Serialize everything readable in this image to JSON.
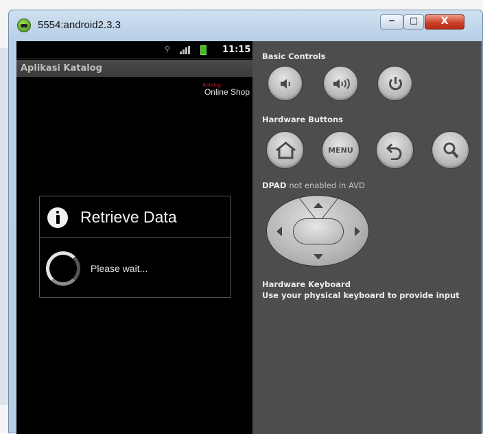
{
  "window": {
    "title": "5554:android2.3.3",
    "minimize_glyph": "‒",
    "maximize_glyph": "□",
    "close_glyph": "X"
  },
  "device": {
    "status_bar": {
      "time": "11:15"
    },
    "app_title": "Aplikasi Katalog",
    "brand": {
      "small": "Katalog",
      "main": "Online Shop"
    },
    "dialog": {
      "title": "Retrieve Data",
      "message": "Please wait..."
    }
  },
  "controls": {
    "basic_label": "Basic Controls",
    "hardware_label": "Hardware Buttons",
    "dpad_label": "DPAD",
    "dpad_note": "not enabled in AVD",
    "keyboard_label": "Hardware Keyboard",
    "keyboard_note": "Use your physical keyboard to provide input",
    "menu_label": "MENU",
    "icons": [
      "volume-down-icon",
      "volume-up-icon",
      "power-icon",
      "home-icon",
      "menu-icon",
      "back-icon",
      "search-icon"
    ]
  },
  "colors": {
    "panel": "#4d4d4d",
    "screen": "#000000",
    "brand_red": "#c8202a",
    "battery_green": "#3fbf1a"
  }
}
